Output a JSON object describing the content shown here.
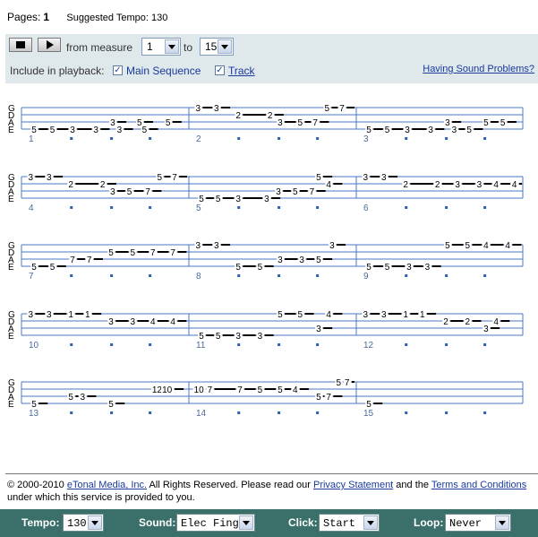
{
  "header": {
    "pages_label": "Pages:",
    "pages_value": "1",
    "tempo_text": "Suggested Tempo: 130"
  },
  "controls": {
    "from_label": "from measure",
    "from_value": "1",
    "to_label": "to",
    "to_value": "15",
    "include_label": "Include in playback:",
    "main_sequence_label": "Main Sequence",
    "main_sequence_checked": true,
    "track_label": "Track",
    "track_checked": true,
    "help_link": "Having Sound Problems?"
  },
  "tab": {
    "strings": [
      "G",
      "D",
      "A",
      "E"
    ],
    "rows": [
      {
        "measures": [
          1,
          2,
          3
        ],
        "notes": [
          [
            "5",
            "5",
            "3",
            "3",
            "3",
            "3",
            "5",
            "5",
            "5"
          ],
          [
            "3",
            "3",
            "2",
            "2",
            "3",
            "5",
            "7",
            "5",
            "7"
          ],
          [
            "5",
            "5",
            "3",
            "3",
            "3",
            "3",
            "5",
            "5",
            "5"
          ]
        ]
      },
      {
        "measures": [
          4,
          5,
          6
        ],
        "notes": [
          [
            "3",
            "3",
            "2",
            "2",
            "3",
            "5",
            "7",
            "5",
            "7"
          ],
          [
            "5",
            "5",
            "3",
            "3",
            "3",
            "5",
            "7",
            "5",
            "4"
          ],
          [
            "3",
            "3",
            "2",
            "2",
            "3",
            "3",
            "4",
            "4"
          ]
        ]
      },
      {
        "measures": [
          7,
          8,
          9
        ],
        "notes": [
          [
            "5",
            "5",
            "7",
            "7",
            "5",
            "5",
            "7",
            "7"
          ],
          [
            "3",
            "3",
            "5",
            "5",
            "3",
            "3",
            "5",
            "3"
          ],
          [
            "5",
            "5",
            "3",
            "3",
            "5",
            "5",
            "4",
            "4"
          ]
        ]
      },
      {
        "measures": [
          10,
          11,
          12
        ],
        "notes": [
          [
            "3",
            "3",
            "1",
            "1",
            "3",
            "3",
            "4",
            "4"
          ],
          [
            "5",
            "5",
            "3",
            "3",
            "5",
            "5",
            "3",
            "4"
          ],
          [
            "3",
            "3",
            "1",
            "1",
            "2",
            "2",
            "3",
            "4"
          ]
        ]
      },
      {
        "measures": [
          13,
          14,
          15
        ],
        "notes": [
          [
            "5",
            "5",
            "3",
            "5",
            "12",
            "10"
          ],
          [
            "10",
            "7",
            "7",
            "5",
            "5",
            "4",
            "5",
            "7",
            "5",
            "7"
          ],
          [
            "5"
          ]
        ]
      }
    ]
  },
  "footer": {
    "copyright": "© 2000-2010",
    "company_link": "eTonal Media, Inc.",
    "rights": " All Rights Reserved.   Please read our ",
    "privacy_link": "Privacy Statement",
    "and_text": " and the ",
    "terms_link": "Terms and Conditions",
    "tail": "under which this service is provided to you."
  },
  "bottom_bar": {
    "tempo_label": "Tempo:",
    "tempo_value": "130",
    "sound_label": "Sound:",
    "sound_value": "Elec Fing",
    "click_label": "Click:",
    "click_value": "Start",
    "loop_label": "Loop:",
    "loop_value": "Never"
  },
  "colors": {
    "control_bg": "#dfe8eb",
    "staff_line": "#4a78c8",
    "bottom_bar": "#3a6f6a",
    "link": "#1a3a9c"
  }
}
